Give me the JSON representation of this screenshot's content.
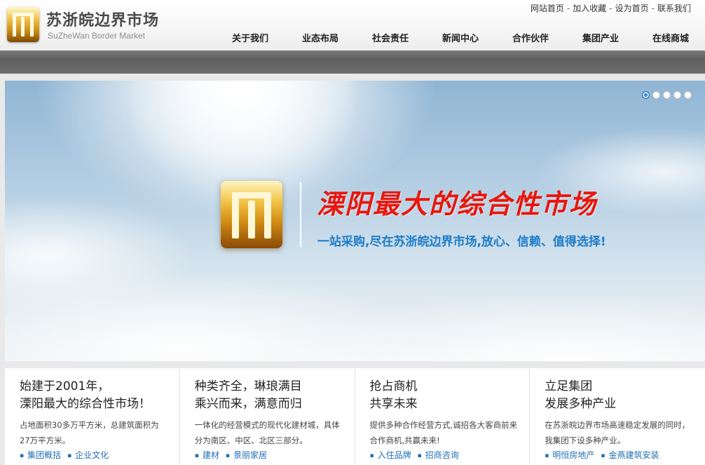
{
  "header": {
    "title": "苏浙皖边界市场",
    "subtitle": "SuZheWan Border Market",
    "top_links": [
      "网站首页",
      "加入收藏",
      "设为首页",
      "联系我们"
    ],
    "nav": [
      "关于我们",
      "业态布局",
      "社会责任",
      "新闻中心",
      "合作伙伴",
      "集团产业",
      "在线商城"
    ]
  },
  "banner": {
    "headline": "溧阳最大的综合性市场",
    "tagline": "一站采购,尽在苏浙皖边界市场,放心、信赖、值得选择!",
    "slide_count": 5,
    "active_slide": 1
  },
  "features": [
    {
      "title_line1": "始建于2001年，",
      "title_line2": "溧阳最大的综合性市场！",
      "desc": "占地面积30多万平方米，总建筑面积为27万平方米。",
      "links": [
        "集团概括",
        "企业文化"
      ]
    },
    {
      "title_line1": "种类齐全，琳琅满目",
      "title_line2": "乘兴而来，满意而归",
      "desc": "一体化的经营模式的现代化建材城，具体分为南区、中区、北区三部分。",
      "links": [
        "建材",
        "景丽家居"
      ]
    },
    {
      "title_line1": "抢占商机",
      "title_line2": "共享未来",
      "desc": "提供多种合作经营方式,诚招各大客商前来合作商机,共赢未来!",
      "links": [
        "入住品牌",
        "招商咨询"
      ]
    },
    {
      "title_line1": "立足集团",
      "title_line2": "发展多种产业",
      "desc": "在苏浙皖边界市场高速稳定发展的同时，我集团下设多种产业。",
      "links": [
        "明恒房地产",
        "金燕建筑安装"
      ]
    }
  ],
  "colors": {
    "accent_blue": "#1f6eb5",
    "headline_red": "#e8160c",
    "tagline_blue": "#1d7bc7",
    "band_grey": "#6b6b6b"
  }
}
